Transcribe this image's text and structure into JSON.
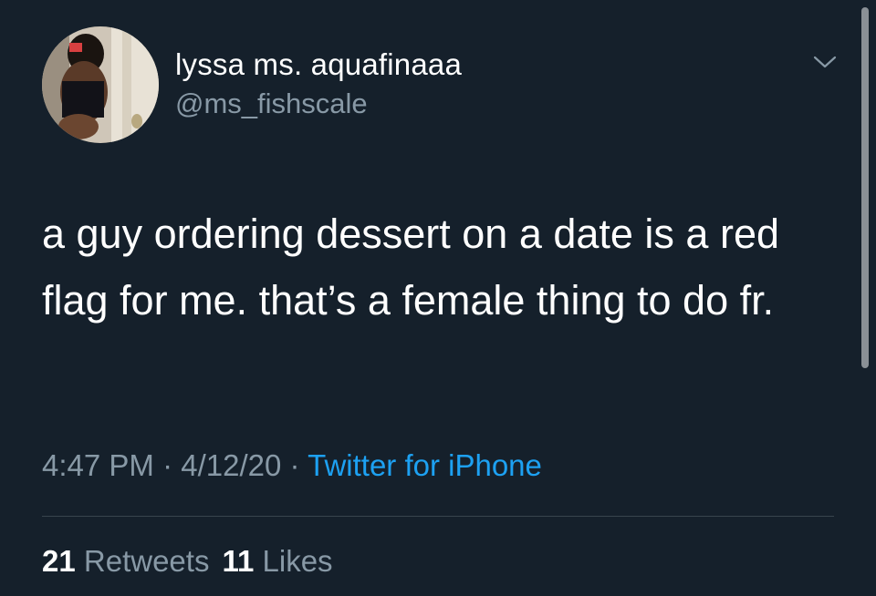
{
  "tweet": {
    "display_name": "lyssa ms. aquafinaaa",
    "handle": "@ms_fishscale",
    "text": "a guy ordering dessert on a date is a red flag for me. that’s a female thing to do fr.",
    "time": "4:47 PM",
    "date": "4/12/20",
    "separator": "·",
    "source": "Twitter for iPhone",
    "retweets_count": "21",
    "retweets_label": "Retweets",
    "likes_count": "11",
    "likes_label": "Likes"
  },
  "icons": {
    "menu": "chevron-down-icon",
    "avatar": "profile-avatar"
  },
  "colors": {
    "background": "#15202b",
    "text": "#ffffff",
    "muted": "#8899a6",
    "link": "#1da1f2",
    "divider": "#38444d"
  }
}
